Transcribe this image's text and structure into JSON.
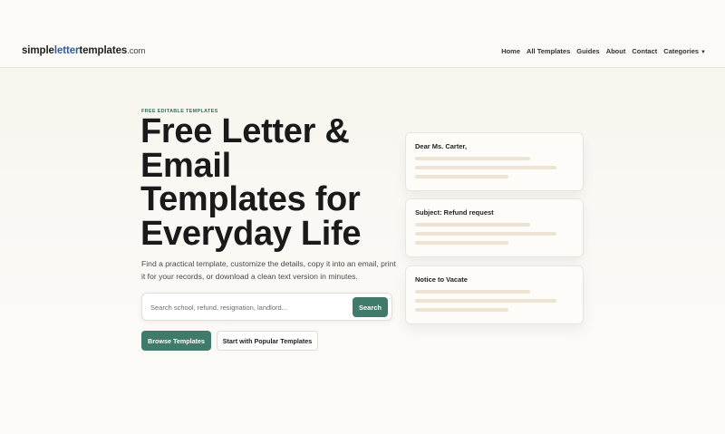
{
  "header": {
    "logo": {
      "part1": "simple",
      "part2": "letter",
      "part3": "templates",
      "tld": ".com"
    },
    "nav": [
      {
        "label": "Home"
      },
      {
        "label": "All Templates"
      },
      {
        "label": "Guides"
      },
      {
        "label": "About"
      },
      {
        "label": "Contact"
      },
      {
        "label": "Categories",
        "icon": "caret-down-icon"
      }
    ]
  },
  "hero": {
    "eyebrow": "FREE EDITABLE TEMPLATES",
    "title": "Free Letter & Email Templates for Everyday Life",
    "subtitle": "Find a practical template, customize the details, copy it into an email, print it for your records, or download a clean text version in minutes.",
    "search": {
      "placeholder": "Search school, refund, resignation, landlord...",
      "value": "",
      "button_label": "Search"
    },
    "primary_button": "Browse Templates",
    "secondary_button": "Start with Popular Templates"
  },
  "preview_cards": [
    {
      "title": "Dear Ms. Carter,"
    },
    {
      "title": "Subject: Refund request"
    },
    {
      "title": "Notice to Vacate"
    }
  ],
  "colors": {
    "accent": "#3f7a6b",
    "logo_accent": "#2f5d9f",
    "background": "#faf8f3",
    "placeholder_line": "#ede4d4"
  }
}
